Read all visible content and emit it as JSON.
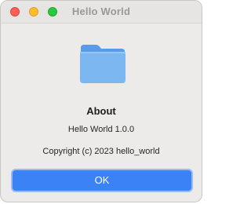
{
  "window": {
    "title": "Hello World"
  },
  "about": {
    "heading": "About",
    "app_icon": "folder-icon",
    "version_line": "Hello World 1.0.0",
    "copyright_line": "Copyright (c) 2023 hello_world"
  },
  "buttons": {
    "ok_label": "OK"
  },
  "colors": {
    "accent": "#3b82f7",
    "close": "#fe5f57",
    "minimize": "#febc2e",
    "zoom": "#28c840",
    "folder": "#7cb7f2"
  }
}
